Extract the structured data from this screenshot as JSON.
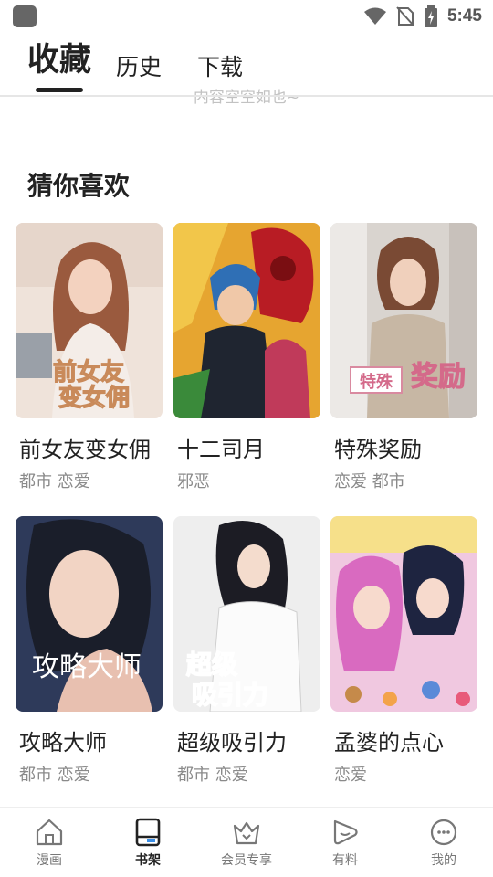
{
  "status_bar": {
    "time": "5:45"
  },
  "header": {
    "tabs": [
      {
        "label": "收藏",
        "active": true
      },
      {
        "label": "历史",
        "active": false
      },
      {
        "label": "下载",
        "active": false
      }
    ],
    "empty_hint": "内容空空如也~"
  },
  "recommend": {
    "title": "猜你喜欢",
    "items": [
      {
        "title": "前女友变女佣",
        "tags": "都市 恋爱",
        "cover_text": "前女友变女佣"
      },
      {
        "title": "十二司月",
        "tags": "邪恶",
        "cover_text": ""
      },
      {
        "title": "特殊奖励",
        "tags": "恋爱 都市",
        "cover_text": "特殊奖励"
      },
      {
        "title": "攻略大师",
        "tags": "都市 恋爱",
        "cover_text": "攻略大师"
      },
      {
        "title": "超级吸引力",
        "tags": "都市 恋爱",
        "cover_text": "超级吸引力"
      },
      {
        "title": "孟婆的点心",
        "tags": "恋爱",
        "cover_text": ""
      }
    ]
  },
  "bottom_nav": {
    "items": [
      {
        "label": "漫画",
        "icon": "home-icon",
        "active": false
      },
      {
        "label": "书架",
        "icon": "bookshelf-icon",
        "active": true
      },
      {
        "label": "会员专享",
        "icon": "crown-icon",
        "active": false
      },
      {
        "label": "有料",
        "icon": "play-icon",
        "active": false
      },
      {
        "label": "我的",
        "icon": "smiley-icon",
        "active": false
      }
    ]
  },
  "colors": {
    "accent": "#222222",
    "inactive": "#777777",
    "tag": "#8a8a8a"
  }
}
